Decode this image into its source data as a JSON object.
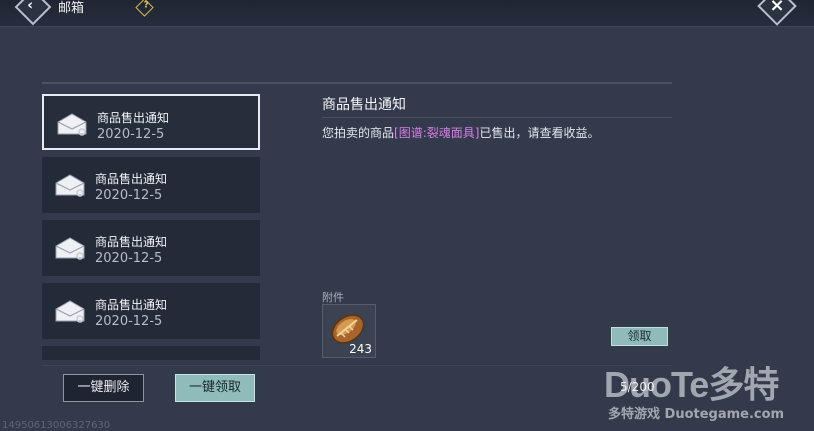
{
  "header": {
    "title": "邮箱",
    "help_glyph": "?",
    "back_icon": "chevron-left-icon",
    "close_icon": "close-icon"
  },
  "mail_list": {
    "items": [
      {
        "title": "商品售出通知",
        "date": "2020-12-5",
        "selected": true
      },
      {
        "title": "商品售出通知",
        "date": "2020-12-5",
        "selected": false
      },
      {
        "title": "商品售出通知",
        "date": "2020-12-5",
        "selected": false
      },
      {
        "title": "商品售出通知",
        "date": "2020-12-5",
        "selected": false
      }
    ]
  },
  "detail": {
    "title": "商品售出通知",
    "body_prefix": "您拍卖的商品",
    "item_name": "[图谱:裂魂面具]",
    "body_suffix": "已售出，请查看收益。",
    "highlight_color": "#d77ee6",
    "attachment_label": "附件",
    "attachment": {
      "icon": "coin-pouch-icon",
      "count": "243"
    },
    "claim_label": "领取"
  },
  "footer": {
    "delete_all_label": "一键删除",
    "claim_all_label": "一键领取",
    "mail_count": "5/200",
    "id_text": "14950613006327630"
  },
  "watermark": {
    "logo": "DuoTe多特",
    "url": "多特游戏 Duotegame.com"
  },
  "colors": {
    "accent": "#8fbcbb",
    "background": "#323a4c",
    "panel": "#232a38"
  }
}
